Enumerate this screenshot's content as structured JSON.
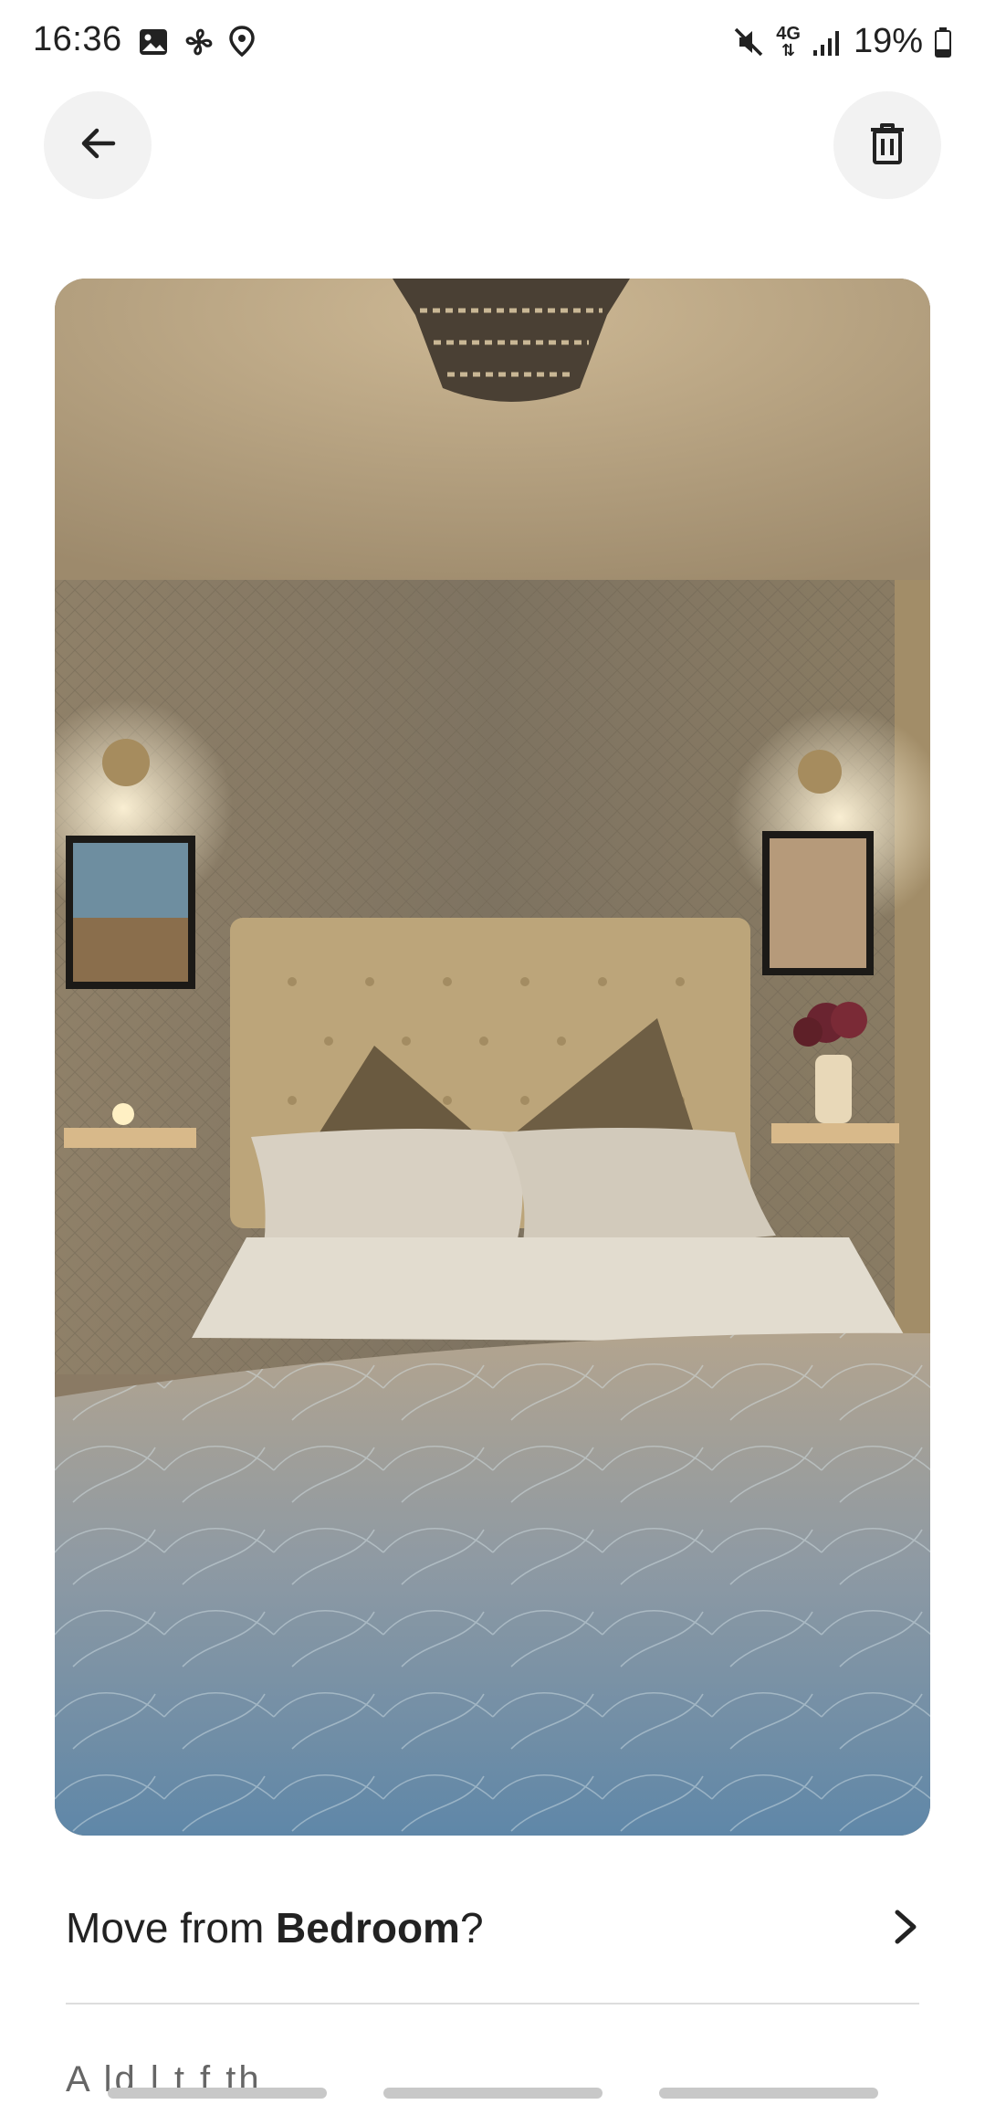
{
  "status_bar": {
    "time": "16:36",
    "network": "4G",
    "battery": "19%",
    "left_icons": [
      "image-icon",
      "fan-icon",
      "location-icon"
    ],
    "right_icons": [
      "mute-icon",
      "signal-icon",
      "battery-icon"
    ]
  },
  "header": {
    "back_icon": "arrow-left-icon",
    "delete_icon": "trash-icon"
  },
  "photo": {
    "subject": "bedroom"
  },
  "move_row": {
    "prefix": "Move from ",
    "room": "Bedroom",
    "suffix": "?",
    "icon": "chevron-right-icon"
  },
  "truncated_text": "A ld  l    t  f   th  ",
  "colors": {
    "button_bg": "#f2f2f2",
    "text": "#222222",
    "divider": "#dddddd"
  }
}
